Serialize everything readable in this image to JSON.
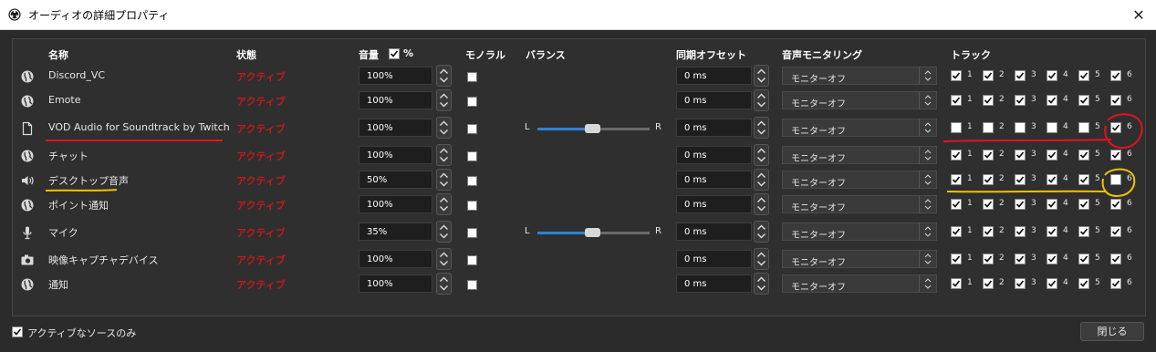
{
  "window": {
    "title": "オーディオの詳細プロパティ",
    "close_glyph": "✕"
  },
  "headers": {
    "name": "名称",
    "status": "状態",
    "volume": "音量",
    "volume_percent_label": "%",
    "mono": "モノラル",
    "balance": "バランス",
    "sync_offset": "同期オフセット",
    "monitoring": "音声モニタリング",
    "tracks": "トラック"
  },
  "balance_labels": {
    "left": "L",
    "right": "R"
  },
  "track_numbers": [
    "1",
    "2",
    "3",
    "4",
    "5",
    "6"
  ],
  "rows": [
    {
      "icon": "globe-icon",
      "name": "Discord_VC",
      "status": "アクティブ",
      "volume": "100%",
      "mono": false,
      "balance": false,
      "offset": "0 ms",
      "monitoring": "モニターオフ",
      "tracks": [
        true,
        true,
        true,
        true,
        true,
        true
      ]
    },
    {
      "icon": "globe-icon",
      "name": "Emote",
      "status": "アクティブ",
      "volume": "100%",
      "mono": false,
      "balance": false,
      "offset": "0 ms",
      "monitoring": "モニターオフ",
      "tracks": [
        true,
        true,
        true,
        true,
        true,
        true
      ]
    },
    {
      "icon": "file-icon",
      "name": "VOD Audio for Soundtrack by Twitch",
      "status": "アクティブ",
      "volume": "100%",
      "mono": false,
      "balance": true,
      "offset": "0 ms",
      "monitoring": "モニターオフ",
      "tracks": [
        false,
        false,
        false,
        false,
        false,
        true
      ]
    },
    {
      "icon": "globe-icon",
      "name": "チャット",
      "status": "アクティブ",
      "volume": "100%",
      "mono": false,
      "balance": false,
      "offset": "0 ms",
      "monitoring": "モニターオフ",
      "tracks": [
        true,
        true,
        true,
        true,
        true,
        true
      ]
    },
    {
      "icon": "speaker-icon",
      "name": "デスクトップ音声",
      "status": "アクティブ",
      "volume": "50%",
      "mono": false,
      "balance": false,
      "offset": "0 ms",
      "monitoring": "モニターオフ",
      "tracks": [
        true,
        true,
        true,
        true,
        true,
        false
      ]
    },
    {
      "icon": "globe-icon",
      "name": "ポイント通知",
      "status": "アクティブ",
      "volume": "100%",
      "mono": false,
      "balance": false,
      "offset": "0 ms",
      "monitoring": "モニターオフ",
      "tracks": [
        true,
        true,
        true,
        true,
        true,
        true
      ]
    },
    {
      "icon": "microphone-icon",
      "name": "マイク",
      "status": "アクティブ",
      "volume": "35%",
      "mono": false,
      "balance": true,
      "offset": "0 ms",
      "monitoring": "モニターオフ",
      "tracks": [
        true,
        true,
        true,
        true,
        true,
        true
      ]
    },
    {
      "icon": "camera-icon",
      "name": "映像キャプチャデバイス",
      "status": "アクティブ",
      "volume": "100%",
      "mono": false,
      "balance": false,
      "offset": "0 ms",
      "monitoring": "モニターオフ",
      "tracks": [
        true,
        true,
        true,
        true,
        true,
        true
      ]
    },
    {
      "icon": "globe-icon",
      "name": "通知",
      "status": "アクティブ",
      "volume": "100%",
      "mono": false,
      "balance": false,
      "offset": "0 ms",
      "monitoring": "モニターオフ",
      "tracks": [
        true,
        true,
        true,
        true,
        true,
        true
      ]
    }
  ],
  "footer": {
    "active_only_label": "アクティブなソースのみ",
    "active_only_checked": true,
    "close_label": "閉じる"
  },
  "colors": {
    "status_active": "#c41a1a",
    "accent": "#2a82da",
    "annotation_red": "#e0141e",
    "annotation_yellow": "#f2c200"
  }
}
